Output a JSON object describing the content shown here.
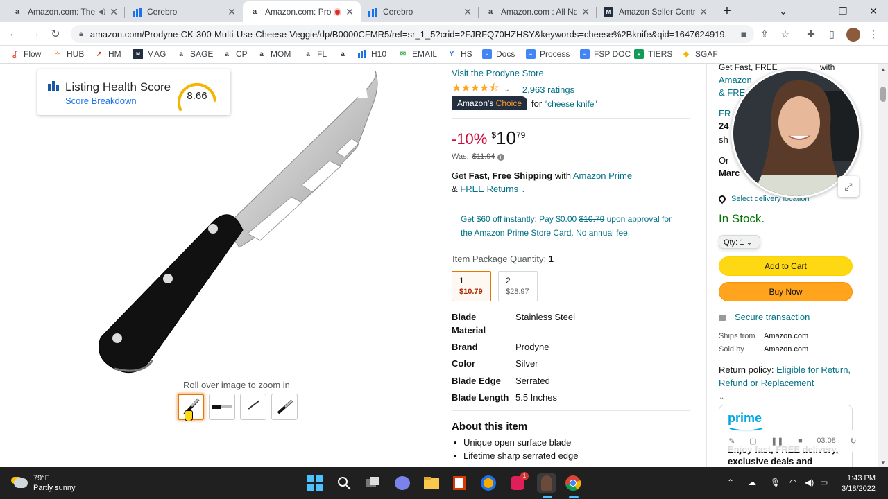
{
  "browser": {
    "tabs": [
      {
        "title": "Amazon.com: The",
        "favicon": "a",
        "audio": true
      },
      {
        "title": "Cerebro",
        "favicon": "cerebro"
      },
      {
        "title": "Amazon.com: Pro",
        "favicon": "a",
        "active": true,
        "recording": true
      },
      {
        "title": "Cerebro",
        "favicon": "cerebro"
      },
      {
        "title": "Amazon.com : All Nat",
        "favicon": "a"
      },
      {
        "title": "Amazon Seller Centra",
        "favicon": "seller"
      }
    ],
    "url": "amazon.com/Prodyne-CK-300-Multi-Use-Cheese-Veggie/dp/B0000CFMR5/ref=sr_1_5?crid=2FJRFQ70HZHSY&keywords=cheese%2Bknife&qid=1647624919...",
    "bookmarks": [
      "Flow",
      "HUB",
      "HM",
      "MAG",
      "SAGE",
      "CP",
      "MOM",
      "FL",
      "H10",
      "EMAIL",
      "HS",
      "Docs",
      "Process",
      "FSP DOC",
      "TIERS",
      "SGAF"
    ]
  },
  "extension": {
    "title": "Listing Health Score",
    "subtitle": "Score Breakdown",
    "score": "8.66",
    "score_fraction": 0.866
  },
  "gallery": {
    "zoom_hint": "Roll over image to zoom in"
  },
  "product": {
    "store_link": "Visit the Prodyne Store",
    "rating": 4.5,
    "ratings_count": "2,963 ratings",
    "badge_prefix": "Amazon's",
    "badge_choice": "Choice",
    "badge_for": "for",
    "badge_keyword": "\"cheese knife\"",
    "discount": "-10%",
    "currency": "$",
    "price_whole": "10",
    "price_fraction": "79",
    "was_label": "Was:",
    "was_price": "$11.94",
    "shipping_get": "Get ",
    "shipping_bold": "Fast, Free Shipping",
    "shipping_with": " with ",
    "shipping_prime": "Amazon Prime",
    "returns_amp": "& ",
    "returns_link": "FREE Returns",
    "promo_a": "Get $60 off instantly: Pay $0.00 ",
    "promo_strike": "$10.79",
    "promo_b": " upon approval for the Amazon Prime Store Card. No annual fee.",
    "qty_label": "Item Package Quantity:",
    "qty_value": "1",
    "options": [
      {
        "qty": "1",
        "price": "$10.79",
        "selected": true
      },
      {
        "qty": "2",
        "price": "$28.97",
        "selected": false
      }
    ],
    "specs": [
      {
        "k": "Blade Material",
        "v": "Stainless Steel"
      },
      {
        "k": "Brand",
        "v": "Prodyne"
      },
      {
        "k": "Color",
        "v": "Silver"
      },
      {
        "k": "Blade Edge",
        "v": "Serrated"
      },
      {
        "k": "Blade Length",
        "v": "5.5 Inches"
      }
    ],
    "about_title": "About this item",
    "bullets": [
      "Unique open surface blade",
      "Lifetime sharp serrated edge"
    ]
  },
  "buybox": {
    "get_fast": "Get Fast, FREE",
    "with": "with",
    "amazon_prime_partial": "Amazon",
    "free_partial": "& FRE",
    "fr": "FR",
    "num": "24",
    "sh": "sh",
    "or": "Or",
    "marc": "Marc",
    "delivery": "Select delivery location",
    "in_stock": "In Stock.",
    "qty": "Qty:  1",
    "add_to_cart": "Add to Cart",
    "buy_now": "Buy Now",
    "secure": "Secure transaction",
    "ships_from_label": "Ships from",
    "ships_from": "Amazon.com",
    "sold_by_label": "Sold by",
    "sold_by": "Amazon.com",
    "return_label": "Return policy: ",
    "return_link": "Eligible for Return, Refund or Replacement",
    "prime_logo": "prime",
    "prime_text": "Enjoy fast, FREE delivery, exclusive deals and award-winning movies & TV"
  },
  "video_overlay": {
    "time": "03:08"
  },
  "taskbar": {
    "temp": "79°F",
    "weather": "Partly sunny",
    "time": "1:43 PM",
    "date": "3/18/2022",
    "notify_badge": "1"
  },
  "colors": {
    "amazon_link": "#007185",
    "discount_red": "#cc0c39",
    "add_to_cart": "#ffd814",
    "buy_now": "#ffa41c",
    "in_stock": "#007600",
    "gauge": "#f5b400"
  }
}
